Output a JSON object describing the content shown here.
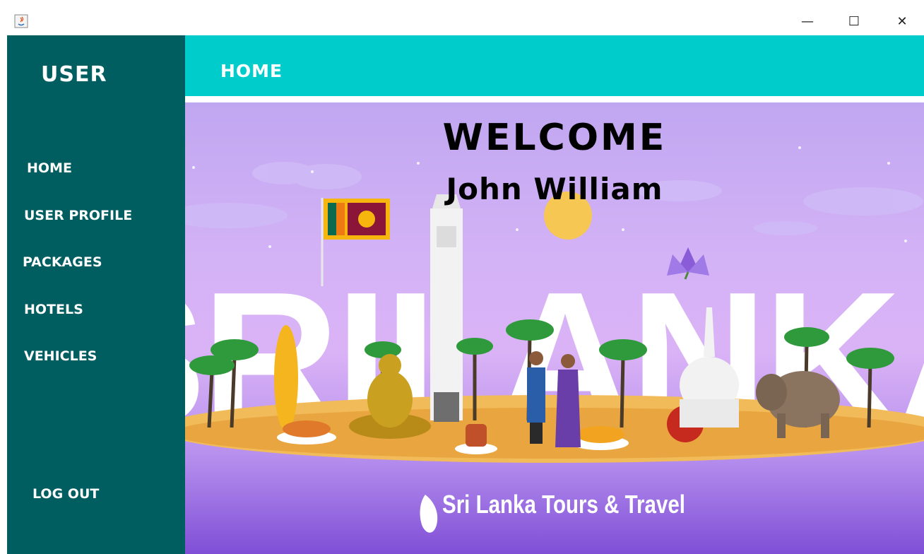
{
  "window": {
    "app_icon": "java-icon",
    "controls": {
      "minimize": "—",
      "maximize": "☐",
      "close": "✕"
    }
  },
  "sidebar": {
    "title": "USER",
    "items": [
      {
        "label": "HOME"
      },
      {
        "label": "USER PROFILE"
      },
      {
        "label": "PACKAGES"
      },
      {
        "label": "HOTELS"
      },
      {
        "label": "VEHICLES"
      }
    ],
    "logout": "LOG OUT"
  },
  "header": {
    "title": "HOME"
  },
  "main": {
    "welcome": "WELCOME",
    "user_name": "John William",
    "banner_word": "SRILANKA",
    "brand": "Sri Lanka Tours & Travel"
  },
  "colors": {
    "sidebar": "#015e60",
    "header": "#01cccc",
    "sky_top": "#c0a7f1",
    "sky_bottom": "#7f4fd6",
    "sand": "#f2bb59"
  }
}
